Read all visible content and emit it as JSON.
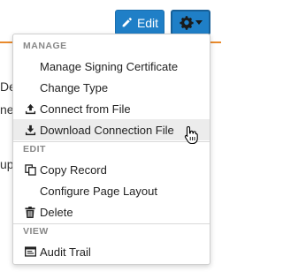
{
  "background": {
    "fragment_1": "Detail",
    "fragment_2": "ne",
    "fragment_3": "ups"
  },
  "toolbar": {
    "edit_label": "Edit",
    "edit_icon": "pencil-icon",
    "gear_icon": "gear-icon",
    "caret_icon": "caret-down-icon",
    "accent_color": "#1f7fc7",
    "divider_color": "#e98a2c"
  },
  "menu": {
    "sections": {
      "manage": "MANAGE",
      "edit": "EDIT",
      "view": "VIEW"
    },
    "items": {
      "manage_signing_certificate": "Manage Signing Certificate",
      "change_type": "Change Type",
      "connect_from_file": "Connect from File",
      "download_connection_file": "Download Connection File",
      "copy_record": "Copy Record",
      "configure_page_layout": "Configure Page Layout",
      "delete": "Delete",
      "audit_trail": "Audit Trail"
    },
    "hovered_item": "Download Connection File"
  }
}
